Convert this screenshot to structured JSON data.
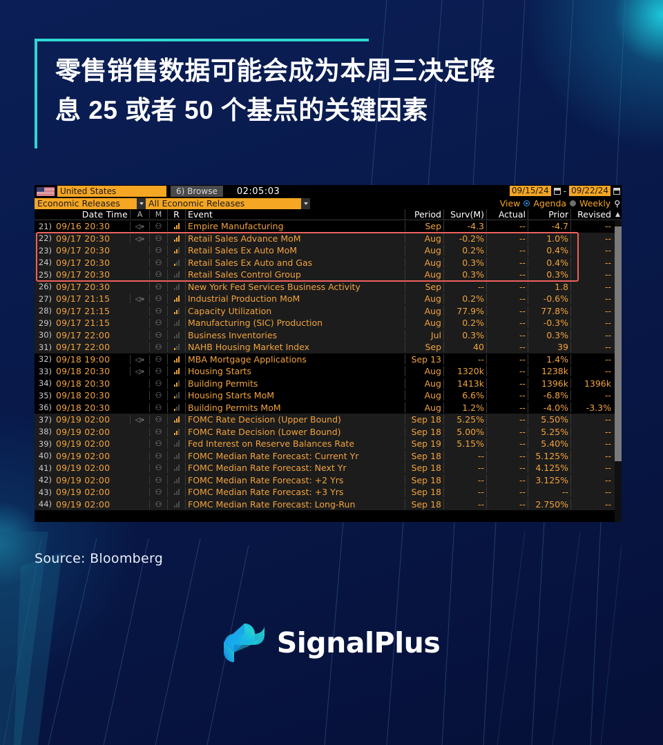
{
  "headline": {
    "text": "零售销售数据可能会成为本周三决定降\n息 25 或者 50 个基点的关键因素"
  },
  "terminal": {
    "country": "United States",
    "browse_label": "Browse",
    "browse_icon": "6)",
    "clock": "02:05:03",
    "date_from": "09/15/24",
    "date_to": "09/22/24",
    "date_sep": "-",
    "category": "Economic Releases",
    "filter": "All Economic Releases",
    "view_label": "View",
    "agenda_label": "Agenda",
    "weekly_label": "Weekly",
    "person_icon": "⚲",
    "headers": {
      "index": "",
      "date_time": "Date Time",
      "a": "A",
      "m": "M",
      "r": "R",
      "event": "Event",
      "period": "Period",
      "surv": "Surv(M)",
      "actual": "Actual",
      "prior": "Prior",
      "revised": "Revised",
      "sort_arrow": "▲"
    },
    "rows": [
      {
        "idx": "21)",
        "date": "09/16 20:30",
        "speaker": true,
        "bell": true,
        "bars": 3,
        "event": "Empire Manufacturing",
        "period": "Sep",
        "surv": "-4.3",
        "actual": "--",
        "prior": "-4.7",
        "revised": "--",
        "band": "a",
        "hl": false
      },
      {
        "idx": "22)",
        "date": "09/17 20:30",
        "speaker": true,
        "bell": true,
        "bars": 3,
        "event": "Retail Sales Advance MoM",
        "period": "Aug",
        "surv": "-0.2%",
        "actual": "--",
        "prior": "1.0%",
        "revised": "--",
        "band": "b",
        "hl": true
      },
      {
        "idx": "23)",
        "date": "09/17 20:30",
        "speaker": false,
        "bell": true,
        "bars": 2,
        "event": "Retail Sales Ex Auto MoM",
        "period": "Aug",
        "surv": "0.2%",
        "actual": "--",
        "prior": "0.4%",
        "revised": "--",
        "band": "b",
        "hl": true
      },
      {
        "idx": "24)",
        "date": "09/17 20:30",
        "speaker": false,
        "bell": true,
        "bars": 1,
        "event": "Retail Sales Ex Auto and Gas",
        "period": "Aug",
        "surv": "0.3%",
        "actual": "--",
        "prior": "0.4%",
        "revised": "--",
        "band": "b",
        "hl": true
      },
      {
        "idx": "25)",
        "date": "09/17 20:30",
        "speaker": false,
        "bell": true,
        "bars": 0,
        "event": "Retail Sales Control Group",
        "period": "Aug",
        "surv": "0.3%",
        "actual": "--",
        "prior": "0.3%",
        "revised": "--",
        "band": "b",
        "hl": true
      },
      {
        "idx": "26)",
        "date": "09/17 20:30",
        "speaker": false,
        "bell": true,
        "bars": -1,
        "event": "New York Fed Services Business Activity",
        "period": "Sep",
        "surv": "--",
        "actual": "--",
        "prior": "1.8",
        "revised": "--",
        "band": "b",
        "hl": false
      },
      {
        "idx": "27)",
        "date": "09/17 21:15",
        "speaker": true,
        "bell": true,
        "bars": 3,
        "event": "Industrial Production MoM",
        "period": "Aug",
        "surv": "0.2%",
        "actual": "--",
        "prior": "-0.6%",
        "revised": "--",
        "band": "b",
        "hl": false
      },
      {
        "idx": "28)",
        "date": "09/17 21:15",
        "speaker": false,
        "bell": true,
        "bars": 2,
        "event": "Capacity Utilization",
        "period": "Aug",
        "surv": "77.9%",
        "actual": "--",
        "prior": "77.8%",
        "revised": "--",
        "band": "b",
        "hl": false
      },
      {
        "idx": "29)",
        "date": "09/17 21:15",
        "speaker": false,
        "bell": true,
        "bars": 0,
        "event": "Manufacturing (SIC) Production",
        "period": "Aug",
        "surv": "0.2%",
        "actual": "--",
        "prior": "-0.3%",
        "revised": "--",
        "band": "b",
        "hl": false
      },
      {
        "idx": "30)",
        "date": "09/17 22:00",
        "speaker": false,
        "bell": true,
        "bars": 0,
        "event": "Business Inventories",
        "period": "Jul",
        "surv": "0.3%",
        "actual": "--",
        "prior": "0.3%",
        "revised": "--",
        "band": "b",
        "hl": false
      },
      {
        "idx": "31)",
        "date": "09/17 22:00",
        "speaker": false,
        "bell": true,
        "bars": 1,
        "event": "NAHB Housing Market Index",
        "period": "Sep",
        "surv": "40",
        "actual": "--",
        "prior": "39",
        "revised": "--",
        "band": "b",
        "hl": false
      },
      {
        "idx": "32)",
        "date": "09/18 19:00",
        "speaker": true,
        "bell": true,
        "bars": 3,
        "event": "MBA Mortgage Applications",
        "period": "Sep 13",
        "surv": "--",
        "actual": "--",
        "prior": "1.4%",
        "revised": "--",
        "band": "a",
        "hl": false
      },
      {
        "idx": "33)",
        "date": "09/18 20:30",
        "speaker": true,
        "bell": true,
        "bars": 3,
        "event": "Housing Starts",
        "period": "Aug",
        "surv": "1320k",
        "actual": "--",
        "prior": "1238k",
        "revised": "--",
        "band": "a",
        "hl": false
      },
      {
        "idx": "34)",
        "date": "09/18 20:30",
        "speaker": false,
        "bell": true,
        "bars": 2,
        "event": "Building Permits",
        "period": "Aug",
        "surv": "1413k",
        "actual": "--",
        "prior": "1396k",
        "revised": "1396k",
        "band": "a",
        "hl": false
      },
      {
        "idx": "35)",
        "date": "09/18 20:30",
        "speaker": false,
        "bell": true,
        "bars": 1,
        "event": "Housing Starts MoM",
        "period": "Aug",
        "surv": "6.6%",
        "actual": "--",
        "prior": "-6.8%",
        "revised": "--",
        "band": "a",
        "hl": false
      },
      {
        "idx": "36)",
        "date": "09/18 20:30",
        "speaker": false,
        "bell": true,
        "bars": 1,
        "event": "Building Permits MoM",
        "period": "Aug",
        "surv": "1.2%",
        "actual": "--",
        "prior": "-4.0%",
        "revised": "-3.3%",
        "band": "a",
        "hl": false
      },
      {
        "idx": "37)",
        "date": "09/19 02:00",
        "speaker": true,
        "bell": true,
        "bars": 3,
        "event": "FOMC Rate Decision (Upper Bound)",
        "period": "Sep 18",
        "surv": "5.25%",
        "actual": "--",
        "prior": "5.50%",
        "revised": "--",
        "band": "b",
        "hl": false
      },
      {
        "idx": "38)",
        "date": "09/19 02:00",
        "speaker": false,
        "bell": true,
        "bars": 2,
        "event": "FOMC Rate Decision (Lower Bound)",
        "period": "Sep 18",
        "surv": "5.00%",
        "actual": "--",
        "prior": "5.25%",
        "revised": "--",
        "band": "b",
        "hl": false
      },
      {
        "idx": "39)",
        "date": "09/19 02:00",
        "speaker": false,
        "bell": true,
        "bars": -1,
        "event": "Fed Interest on Reserve Balances Rate",
        "period": "Sep 19",
        "surv": "5.15%",
        "actual": "--",
        "prior": "5.40%",
        "revised": "--",
        "band": "b",
        "hl": false
      },
      {
        "idx": "40)",
        "date": "09/19 02:00",
        "speaker": false,
        "bell": true,
        "bars": -1,
        "event": "FOMC Median Rate Forecast: Current Yr",
        "period": "Sep 18",
        "surv": "--",
        "actual": "--",
        "prior": "5.125%",
        "revised": "--",
        "band": "b",
        "hl": false
      },
      {
        "idx": "41)",
        "date": "09/19 02:00",
        "speaker": false,
        "bell": true,
        "bars": -1,
        "event": "FOMC Median Rate Forecast: Next Yr",
        "period": "Sep 18",
        "surv": "--",
        "actual": "--",
        "prior": "4.125%",
        "revised": "--",
        "band": "b",
        "hl": false
      },
      {
        "idx": "42)",
        "date": "09/19 02:00",
        "speaker": false,
        "bell": true,
        "bars": -1,
        "event": "FOMC Median Rate Forecast: +2 Yrs",
        "period": "Sep 18",
        "surv": "--",
        "actual": "--",
        "prior": "3.125%",
        "revised": "--",
        "band": "b",
        "hl": false
      },
      {
        "idx": "43)",
        "date": "09/19 02:00",
        "speaker": false,
        "bell": true,
        "bars": -1,
        "event": "FOMC Median Rate Forecast: +3 Yrs",
        "period": "Sep 18",
        "surv": "--",
        "actual": "--",
        "prior": "--",
        "revised": "--",
        "band": "b",
        "hl": false
      },
      {
        "idx": "44)",
        "date": "09/19 02:00",
        "speaker": false,
        "bell": true,
        "bars": -1,
        "event": "FOMC Median Rate Forecast: Long-Run",
        "period": "Sep 18",
        "surv": "--",
        "actual": "--",
        "prior": "2.750%",
        "revised": "--",
        "band": "b",
        "hl": false
      }
    ]
  },
  "source": {
    "text": "Source: Bloomberg"
  },
  "logo": {
    "text": "SignalPlus"
  },
  "colors": {
    "accent_teal": "#2fd7d2",
    "terminal_orange": "#f2a33c",
    "field_orange": "#f5a623",
    "highlight_red": "#f0615e",
    "bg_navy": "#0a1b4d"
  }
}
